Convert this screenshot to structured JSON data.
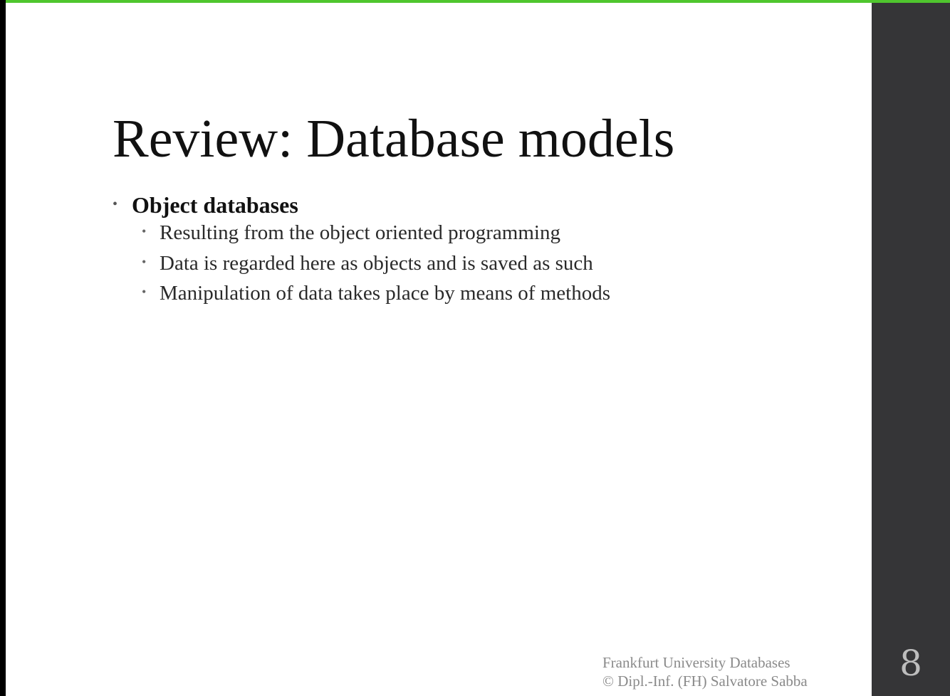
{
  "colors": {
    "accent": "#4fc62e",
    "side_panel": "#353537",
    "slide_background": "#ffffff",
    "outer_background": "#000000"
  },
  "slide": {
    "title": "Review: Database models",
    "bullets": [
      {
        "label": "Object databases",
        "children": [
          "Resulting from the object oriented programming",
          "Data is regarded here as objects and is saved as such",
          "Manipulation of data takes place by means of methods"
        ]
      }
    ],
    "footer": {
      "line1": "Frankfurt University Databases",
      "line2": "© Dipl.-Inf. (FH) Salvatore Sabba"
    },
    "page_number": "8"
  }
}
